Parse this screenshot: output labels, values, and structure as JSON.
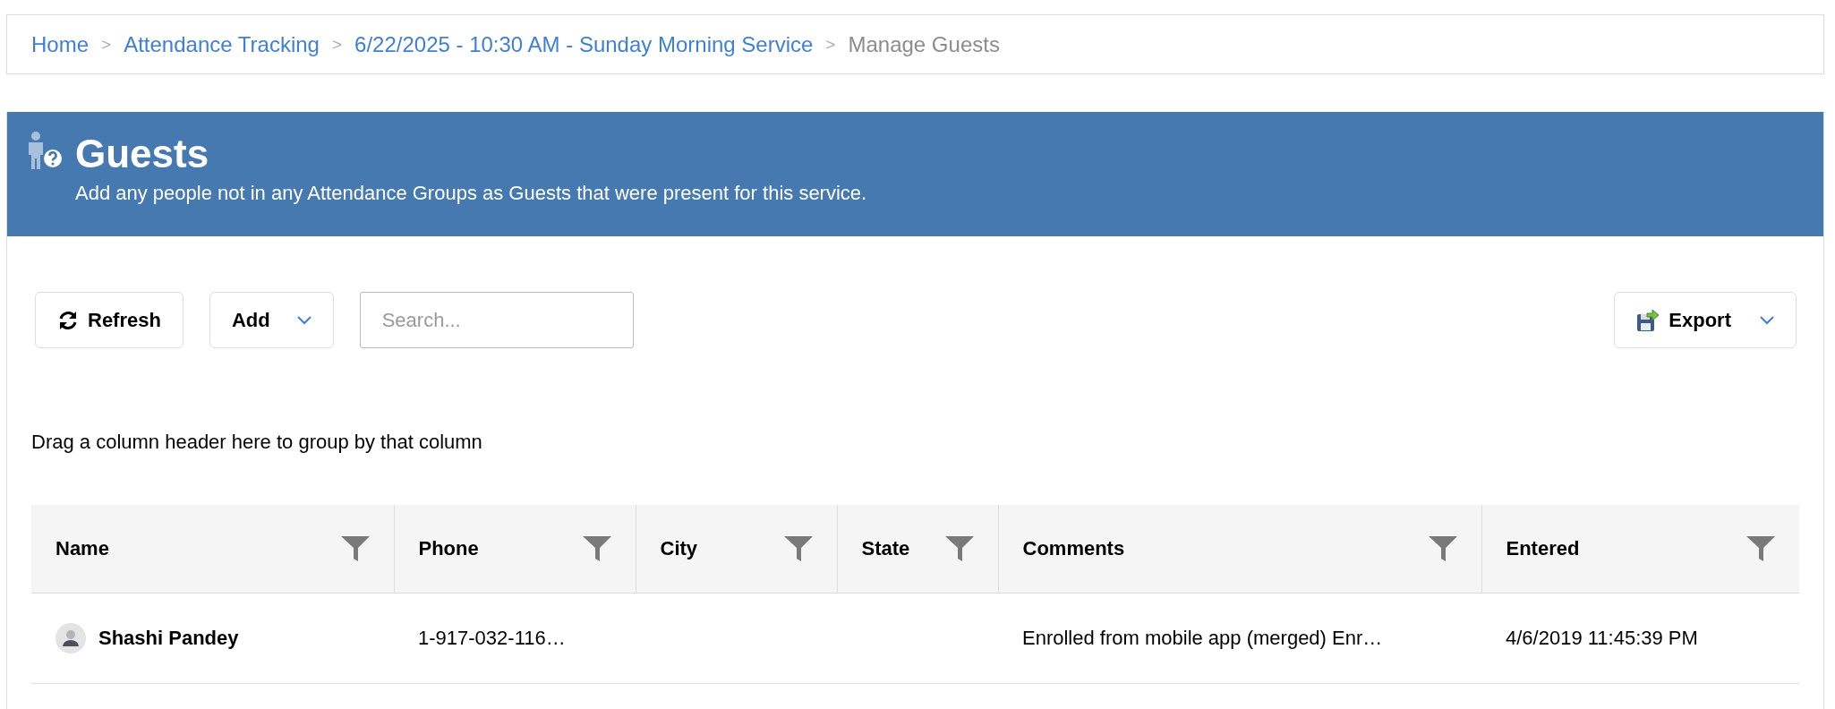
{
  "breadcrumb": {
    "separator": ">",
    "items": [
      {
        "label": "Home",
        "kind": "link"
      },
      {
        "label": "Attendance Tracking",
        "kind": "link"
      },
      {
        "label": "6/22/2025 - 10:30 AM - Sunday Morning Service",
        "kind": "link"
      },
      {
        "label": "Manage Guests",
        "kind": "current"
      }
    ]
  },
  "header": {
    "title": "Guests",
    "subtitle": "Add any people not in any Attendance Groups as Guests that were present for this service."
  },
  "toolbar": {
    "refresh": "Refresh",
    "add": "Add",
    "search": {
      "placeholder": "Search..."
    },
    "export": "Export"
  },
  "group_hint": "Drag a column header here to group by that column",
  "table": {
    "columns": [
      {
        "label": "Name"
      },
      {
        "label": "Phone"
      },
      {
        "label": "City"
      },
      {
        "label": "State"
      },
      {
        "label": "Comments"
      },
      {
        "label": "Entered"
      }
    ],
    "rows": [
      {
        "name": "Shashi Pandey",
        "phone": "1-917-032-116…",
        "comments": "Enrolled from mobile app (merged) Enr…",
        "entered": "4/6/2019 11:45:39 PM"
      }
    ]
  }
}
